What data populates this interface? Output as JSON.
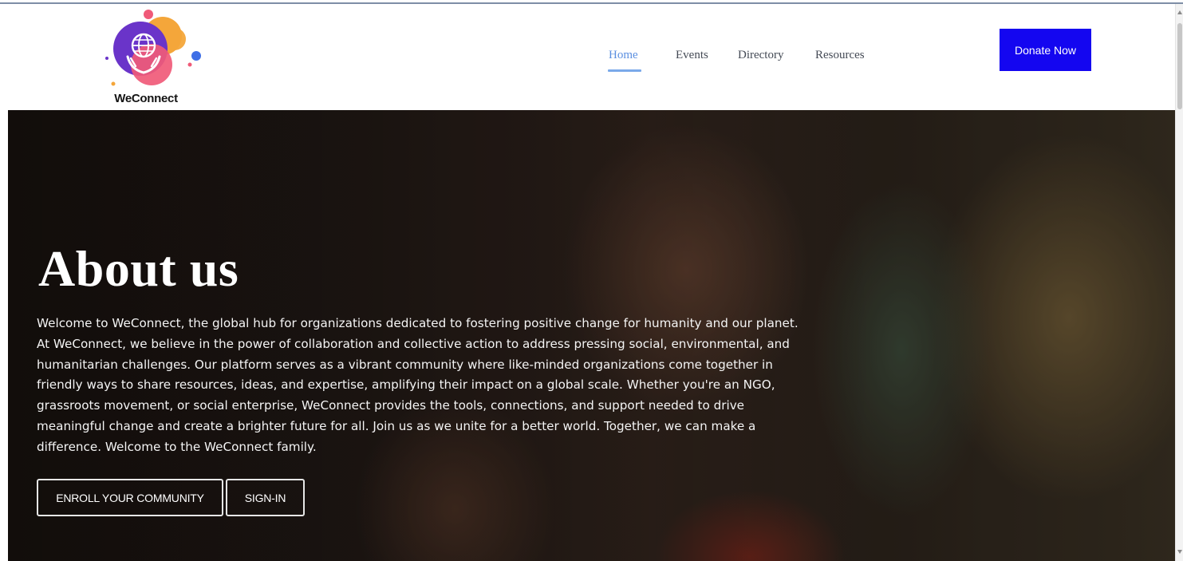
{
  "brand": {
    "name": "WeConnect",
    "colors": {
      "purple": "#6a34c9",
      "orange": "#f4a63a",
      "pink": "#f05a78",
      "blue": "#3f6fe6"
    }
  },
  "nav": {
    "items": [
      {
        "label": "Home",
        "active": true
      },
      {
        "label": "Events"
      },
      {
        "label": "Directory"
      },
      {
        "label": "Resources"
      }
    ],
    "active_color": "#5b8fe0"
  },
  "donate_button": {
    "label": "Donate Now",
    "color": "#1406f0"
  },
  "hero": {
    "title": "About us",
    "body": "Welcome to WeConnect, the global hub for organizations dedicated to fostering positive change for humanity and our planet. At WeConnect, we believe in the power of collaboration and collective action to address pressing social, environmental, and humanitarian challenges. Our platform serves as a vibrant community where like-minded organizations come together in friendly ways to share resources, ideas, and expertise, amplifying their impact on a global scale. Whether you're an NGO, grassroots movement, or social enterprise, WeConnect provides the tools, connections, and support needed to drive meaningful change and create a brighter future for all. Join us as we unite for a better world. Together, we can make a difference. Welcome to the WeConnect family.",
    "enroll_label": "ENROLL YOUR COMMUNITY",
    "signin_label": "SIGN-IN"
  }
}
